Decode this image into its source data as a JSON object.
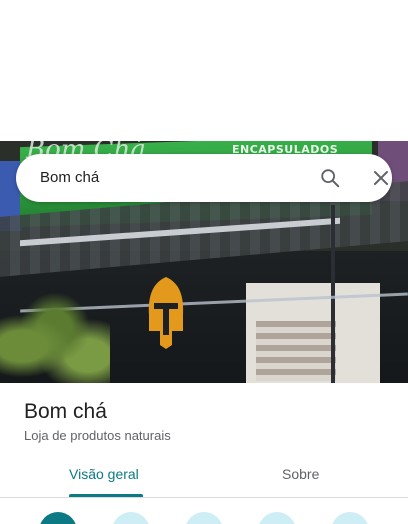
{
  "search": {
    "query": "Bom chá"
  },
  "place": {
    "name": "Bom chá",
    "category": "Loja de produtos naturais"
  },
  "photo": {
    "sign_text": "ENCAPSULADOS",
    "sign_script": "Bom Chá"
  },
  "tabs": [
    {
      "label": "Visão geral",
      "selected": true
    },
    {
      "label": "Sobre",
      "selected": false
    }
  ],
  "colors": {
    "accent": "#0b7a84",
    "action_light": "#cdeef5"
  },
  "icons": {
    "search": "search-icon",
    "close": "close-icon"
  }
}
